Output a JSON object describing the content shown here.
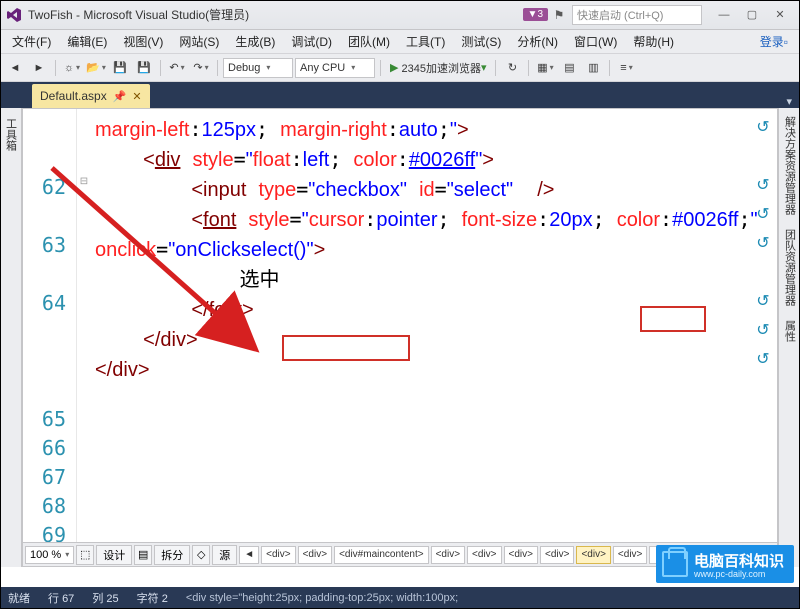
{
  "title": "TwoFish - Microsoft Visual Studio(管理员)",
  "notif_badge": "3",
  "quick_launch_placeholder": "快速启动 (Ctrl+Q)",
  "menus": [
    "文件(F)",
    "编辑(E)",
    "视图(V)",
    "网站(S)",
    "生成(B)",
    "调试(D)",
    "团队(M)",
    "工具(T)",
    "测试(S)",
    "分析(N)",
    "窗口(W)",
    "帮助(H)"
  ],
  "login_label": "登录",
  "toolbar": {
    "config": "Debug",
    "platform": "Any CPU",
    "run_label": "2345加速浏览器"
  },
  "file_tab": {
    "name": "Default.aspx"
  },
  "left_tabs": [
    "工具箱"
  ],
  "right_tabs": [
    "解决方案资源管理器",
    "团队资源管理器",
    "属性"
  ],
  "editor": {
    "zoom": "100 %",
    "views": {
      "design": "设计",
      "split": "拆分",
      "source": "源"
    },
    "breadcrumb": [
      "<div>",
      "<div>",
      "<div#maincontent>",
      "<div>",
      "<div>",
      "<div>",
      "<div>",
      "<div>",
      "<div>"
    ],
    "breadcrumb_selected_index": 7,
    "line_numbers": [
      "62",
      "63",
      "64",
      "65",
      "66",
      "67",
      "68",
      "69"
    ],
    "code": {
      "l61a": "margin-left",
      "l61b": "125px",
      "l61c": "margin-right",
      "l61d": "auto",
      "l62tag": "div",
      "l62attr": "style",
      "l62p1": "float",
      "l62v1": "left",
      "l62p2": "color",
      "l62v2": "#0026ff",
      "l63tag": "input",
      "l63a1": "type",
      "l63v1": "checkbox",
      "l63a2": "id",
      "l63v2": "select",
      "l64tag": "font",
      "l64attr": "style",
      "l64p1": "cursor",
      "l64v1": "pointer",
      "l64p2": "font-size",
      "l64v2": "20px",
      "l64p3": "color",
      "l64v3": "#0026ff",
      "l64a2": "onclick",
      "l64v4": "onClickselect()",
      "l65txt": "选中",
      "l66end": "font",
      "l67end": "div",
      "l68end": "div"
    }
  },
  "status": {
    "ready": "就绪",
    "line_label": "行",
    "line": "67",
    "col_label": "列",
    "col": "25",
    "char_label": "字符",
    "char": "2",
    "path": "<div style=\"height:25px; padding-top:25px; width:100px;"
  },
  "watermark": {
    "cn": "电脑百科知识",
    "url": "www.pc-daily.com"
  }
}
